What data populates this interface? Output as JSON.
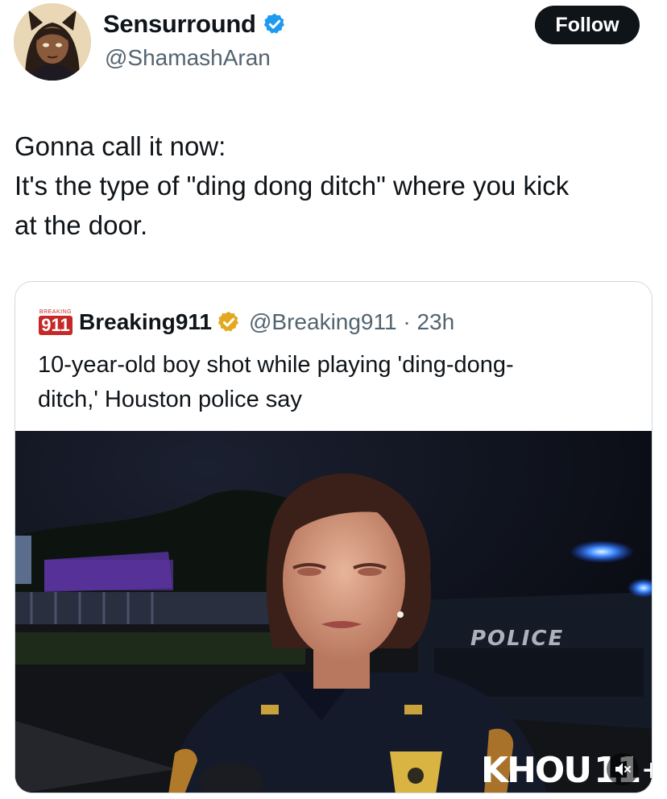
{
  "author": {
    "display_name": "Sensurround",
    "handle": "@ShamashAran",
    "follow_label": "Follow",
    "verified_color": "#1d9bf0"
  },
  "tweet": {
    "lines": [
      "Gonna call it now:",
      "It's the type of \"ding dong ditch\" where you kick",
      "at the door."
    ]
  },
  "quote": {
    "logo_small": "BREAKING",
    "logo_big": "911",
    "name": "Breaking911",
    "handle_time": "@Breaking911 · 23h",
    "badge_color": "#e2a920",
    "lines": [
      "10-year-old boy shot while playing 'ding-dong-",
      "ditch,' Houston police say"
    ],
    "media": {
      "police_label": "POLICE",
      "channel_logo": "KHOU",
      "channel_number": "11",
      "channel_plus": "+"
    }
  }
}
